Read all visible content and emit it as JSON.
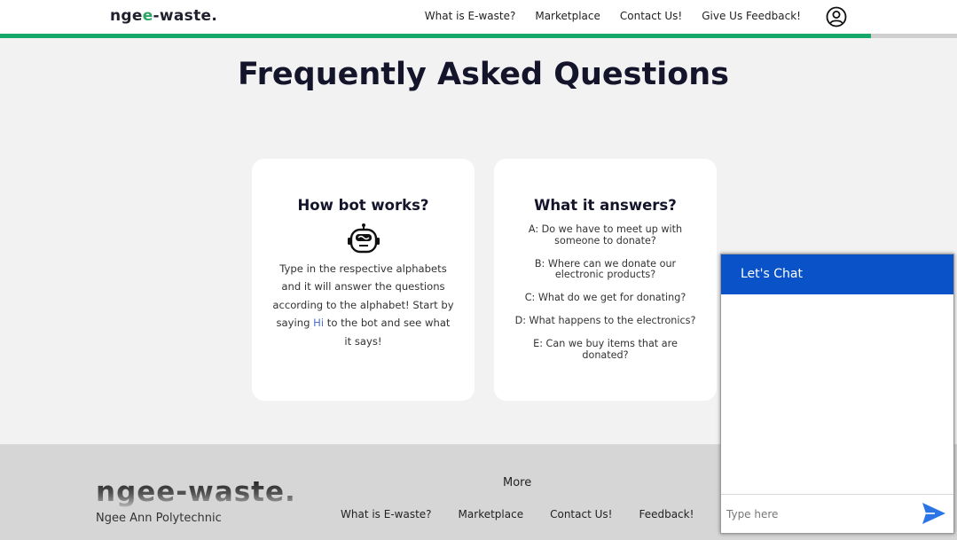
{
  "navbar": {
    "brand_prefix": "ngee-",
    "brand_accent": "e",
    "brand_pre": "nge",
    "brand_rest": "-waste.",
    "links": [
      "What is E-waste?",
      "Marketplace",
      "Contact Us!",
      "Give Us Feedback!"
    ],
    "avatar_icon": "user-circle-icon",
    "scroll_progress": 0.91,
    "accent_color": "#16a86a"
  },
  "page": {
    "title": "Frequently Asked Questions"
  },
  "cards": {
    "how": {
      "title": "How bot works?",
      "icon": "robot-icon",
      "desc_part1": "Type in the respective alphabets and it will answer the questions according to the alphabet! Start by saying ",
      "desc_hi": "Hi",
      "desc_part2": " to the bot and see what it says!"
    },
    "answers": {
      "title": "What it answers?",
      "items": [
        "A: Do we have to meet up with someone to donate?",
        "B: Where can we donate our electronic products?",
        "C: What do we get for donating?",
        "D: What happens to the electronics?",
        "E: Can we buy items that are donated?"
      ]
    }
  },
  "footer": {
    "logo": "ngee-waste.",
    "subtitle": "Ngee Ann Polytechnic",
    "more": "More",
    "links": [
      "What is E-waste?",
      "Marketplace",
      "Contact Us!",
      "Feedback!"
    ]
  },
  "chat": {
    "title": "Let's Chat",
    "input_placeholder": "Type here",
    "send_icon": "send-icon",
    "header_color": "#0a52c7"
  }
}
